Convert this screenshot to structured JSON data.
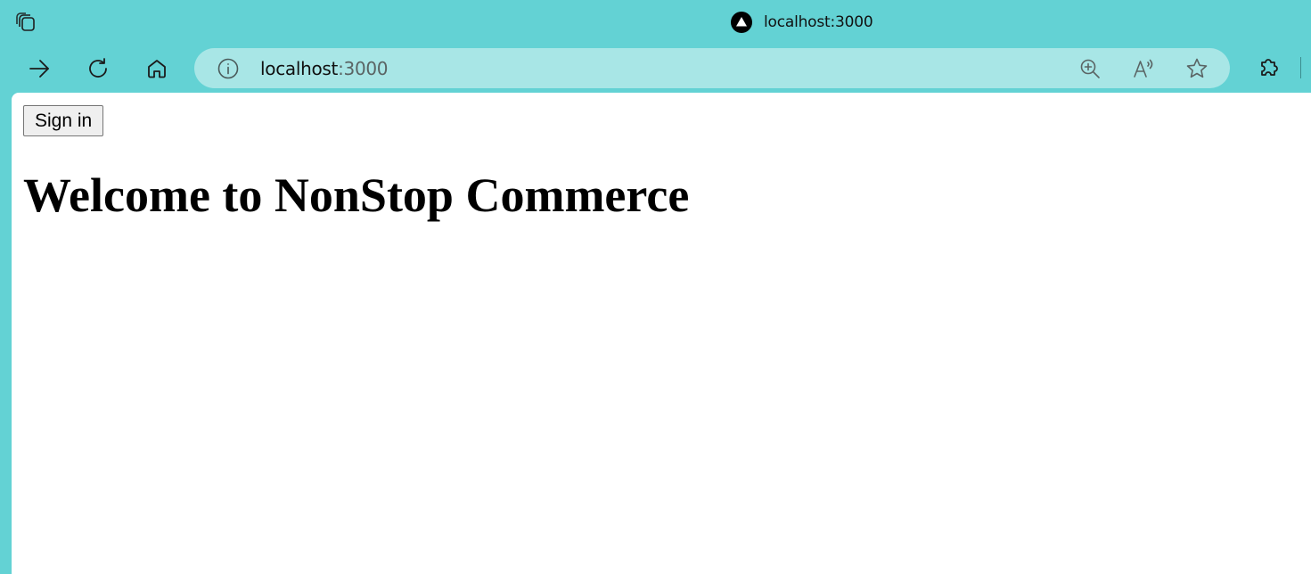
{
  "browser": {
    "tab": {
      "title": "localhost:3000",
      "favicon": "nextjs-triangle-icon"
    },
    "toolbar": {
      "forward_icon": "arrow-right-icon",
      "refresh_icon": "refresh-icon",
      "home_icon": "home-icon"
    },
    "address_bar": {
      "host": "localhost",
      "port": ":3000",
      "info_icon": "info-icon",
      "zoom_icon": "zoom-in-icon",
      "read_aloud_icon": "read-aloud-icon",
      "favorite_icon": "star-icon"
    },
    "extensions_icon": "puzzle-icon",
    "colors": {
      "frame": "#63d2d4",
      "address_bar": "#a8e6e6"
    }
  },
  "page": {
    "signin_label": "Sign in",
    "heading": "Welcome to NonStop Commerce"
  }
}
